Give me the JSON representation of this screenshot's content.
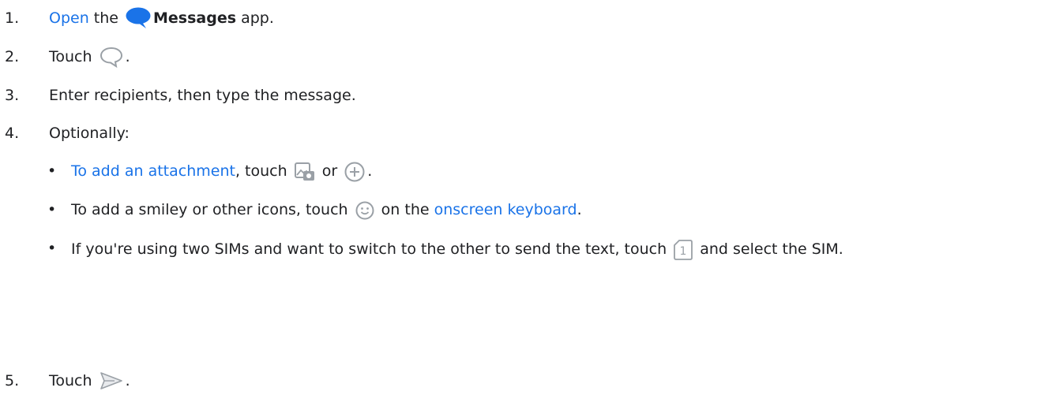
{
  "steps": [
    {
      "number": "1.",
      "link": "Open",
      "text_a": " the ",
      "app_name": "Messages",
      "text_b": " app.",
      "icon": "messages-app-icon"
    },
    {
      "number": "2.",
      "text_a": "Touch ",
      "text_b": ".",
      "icon": "new-chat-bubble-icon"
    },
    {
      "number": "3.",
      "text_a": "Enter recipients, then type the message."
    },
    {
      "number": "4.",
      "text_a": "Optionally:",
      "bullets": [
        {
          "link": "To add an attachment",
          "text_a": ", touch ",
          "text_b": " or ",
          "text_c": ".",
          "icons": [
            "attach-media-icon",
            "add-plus-icon"
          ]
        },
        {
          "text_a": "To add a smiley or other icons, touch ",
          "text_b": " on the ",
          "link": "onscreen keyboard",
          "text_c": ".",
          "icons": [
            "smiley-icon"
          ]
        },
        {
          "text_a": "If you're using two SIMs and want to switch to the other to send the text, touch ",
          "text_b": " and select the SIM.",
          "icons": [
            "sim-1-icon"
          ]
        }
      ]
    },
    {
      "number": "5.",
      "text_a": "Touch ",
      "text_b": ".",
      "icon": "send-arrow-icon"
    }
  ],
  "bullet_char": "•",
  "sim_number": "1",
  "colors": {
    "link": "#1a73e8",
    "text": "#202124",
    "messages_icon": "#1a73e8",
    "icon_gray": "#9aa0a6"
  }
}
